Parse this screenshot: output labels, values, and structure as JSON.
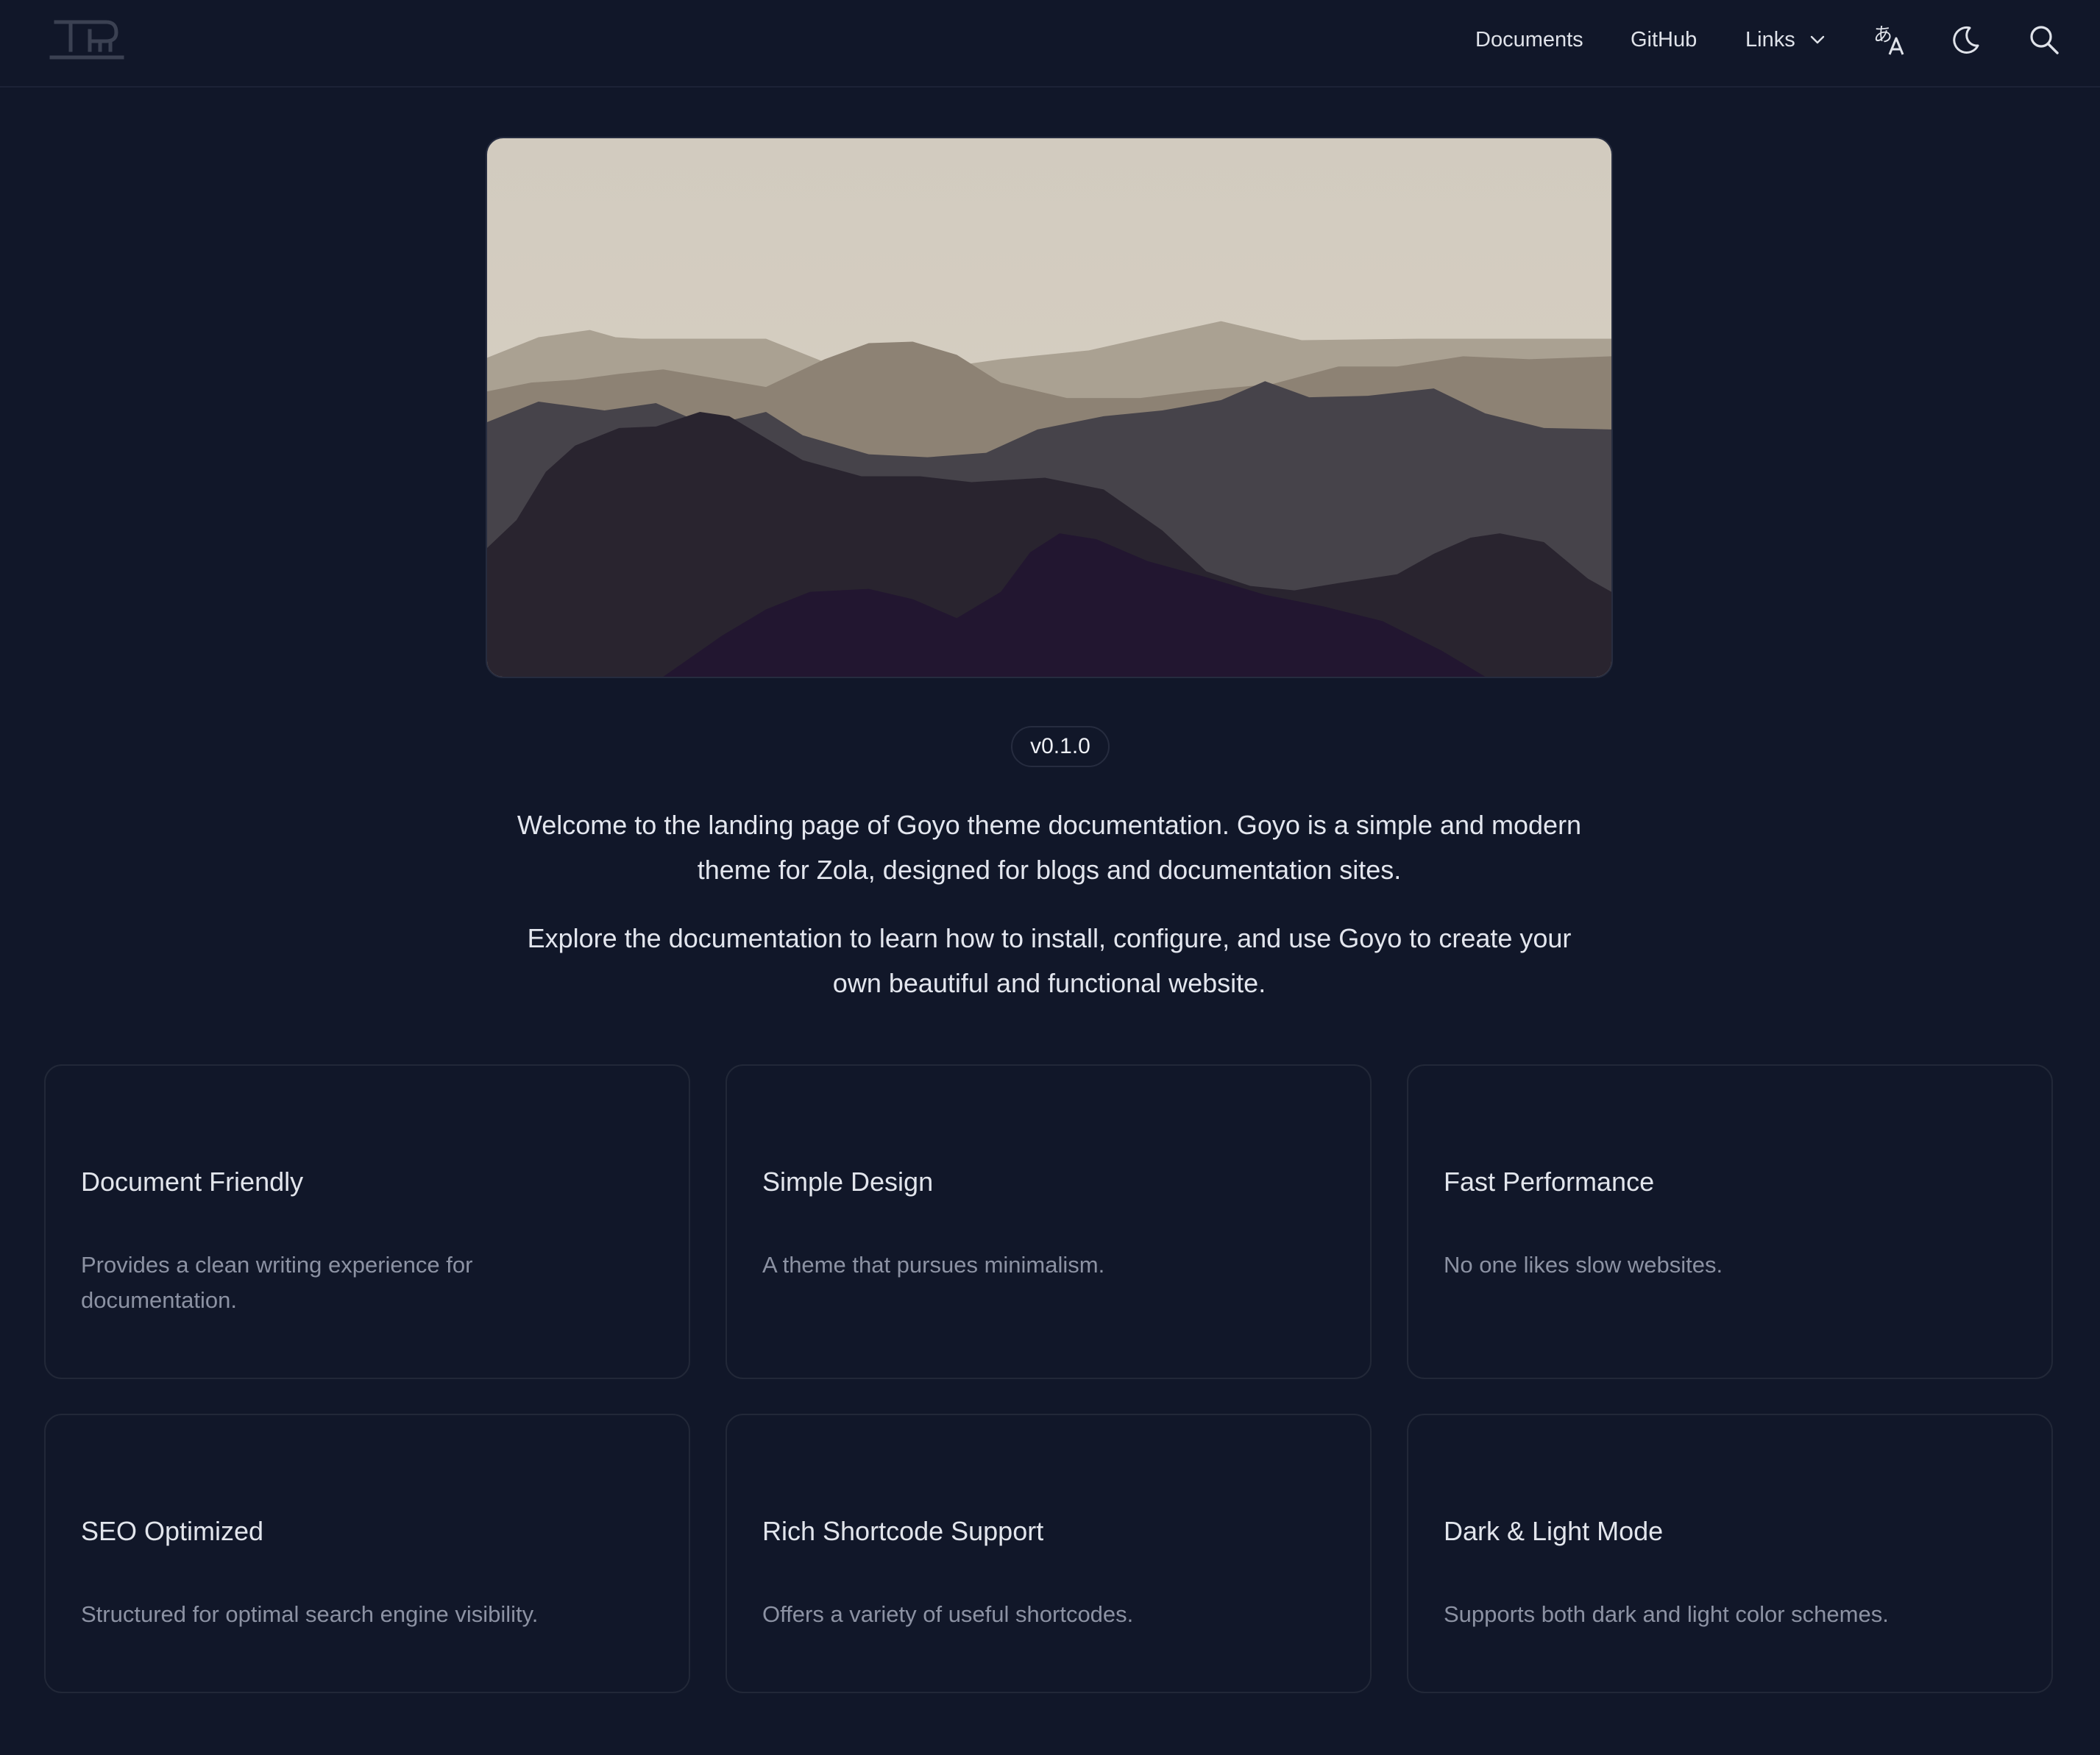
{
  "nav": {
    "logo": "goyo-logo",
    "links": [
      {
        "label": "Documents"
      },
      {
        "label": "GitHub"
      },
      {
        "label": "Links",
        "icon": "chevron-down-icon"
      }
    ],
    "icons": [
      "translate-icon",
      "moon-icon",
      "search-icon"
    ]
  },
  "hero": {
    "image": "mountain-landscape",
    "version": "v0.1.0",
    "paragraphs": [
      "Welcome to the landing page of Goyo theme documentation. Goyo is a simple and modern theme for Zola, designed for blogs and documentation sites.",
      "Explore the documentation to learn how to install, configure, and use Goyo to create your own beautiful and functional website."
    ]
  },
  "features": [
    {
      "title": "Document Friendly",
      "description": "Provides a clean writing experience for documentation."
    },
    {
      "title": "Simple Design",
      "description": "A theme that pursues minimalism."
    },
    {
      "title": "Fast Performance",
      "description": "No one likes slow websites."
    },
    {
      "title": "SEO Optimized",
      "description": "Structured for optimal search engine visibility."
    },
    {
      "title": "Rich Shortcode Support",
      "description": "Offers a variety of useful shortcodes."
    },
    {
      "title": "Dark & Light Mode",
      "description": "Supports both dark and light color schemes."
    }
  ],
  "colors": {
    "background": "#111729",
    "card_border": "#222838",
    "text": "#e2e5ec",
    "muted_text": "#8c92a3"
  }
}
